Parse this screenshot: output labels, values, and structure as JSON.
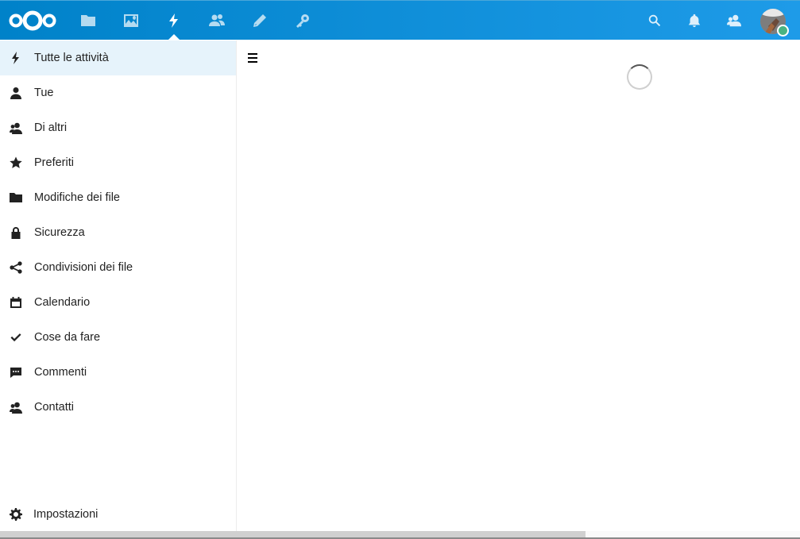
{
  "header": {
    "apps": [
      {
        "name": "files",
        "icon": "folder-icon"
      },
      {
        "name": "photos",
        "icon": "image-icon"
      },
      {
        "name": "activity",
        "icon": "lightning-icon",
        "active": true
      },
      {
        "name": "contacts",
        "icon": "contacts-icon"
      },
      {
        "name": "notes",
        "icon": "pencil-icon"
      },
      {
        "name": "passwords",
        "icon": "key-icon"
      }
    ],
    "right_icons": [
      "search-icon",
      "notifications-icon",
      "contacts-menu-icon"
    ],
    "status_color": "#49b382",
    "accent": "#0082c9"
  },
  "sidebar": {
    "items": [
      {
        "label": "Tutte le attività",
        "icon": "lightning-icon",
        "active": true
      },
      {
        "label": "Tue",
        "icon": "user-icon"
      },
      {
        "label": "Di altri",
        "icon": "users-icon"
      },
      {
        "label": "Preferiti",
        "icon": "star-icon"
      },
      {
        "label": "Modifiche dei file",
        "icon": "folder-icon"
      },
      {
        "label": "Sicurezza",
        "icon": "lock-icon"
      },
      {
        "label": "Condivisioni dei file",
        "icon": "share-icon"
      },
      {
        "label": "Calendario",
        "icon": "calendar-icon"
      },
      {
        "label": "Cose da fare",
        "icon": "checkmark-icon"
      },
      {
        "label": "Commenti",
        "icon": "comment-icon"
      },
      {
        "label": "Contatti",
        "icon": "contacts-icon"
      }
    ],
    "settings": {
      "label": "Impostazioni",
      "icon": "gear-icon"
    }
  }
}
